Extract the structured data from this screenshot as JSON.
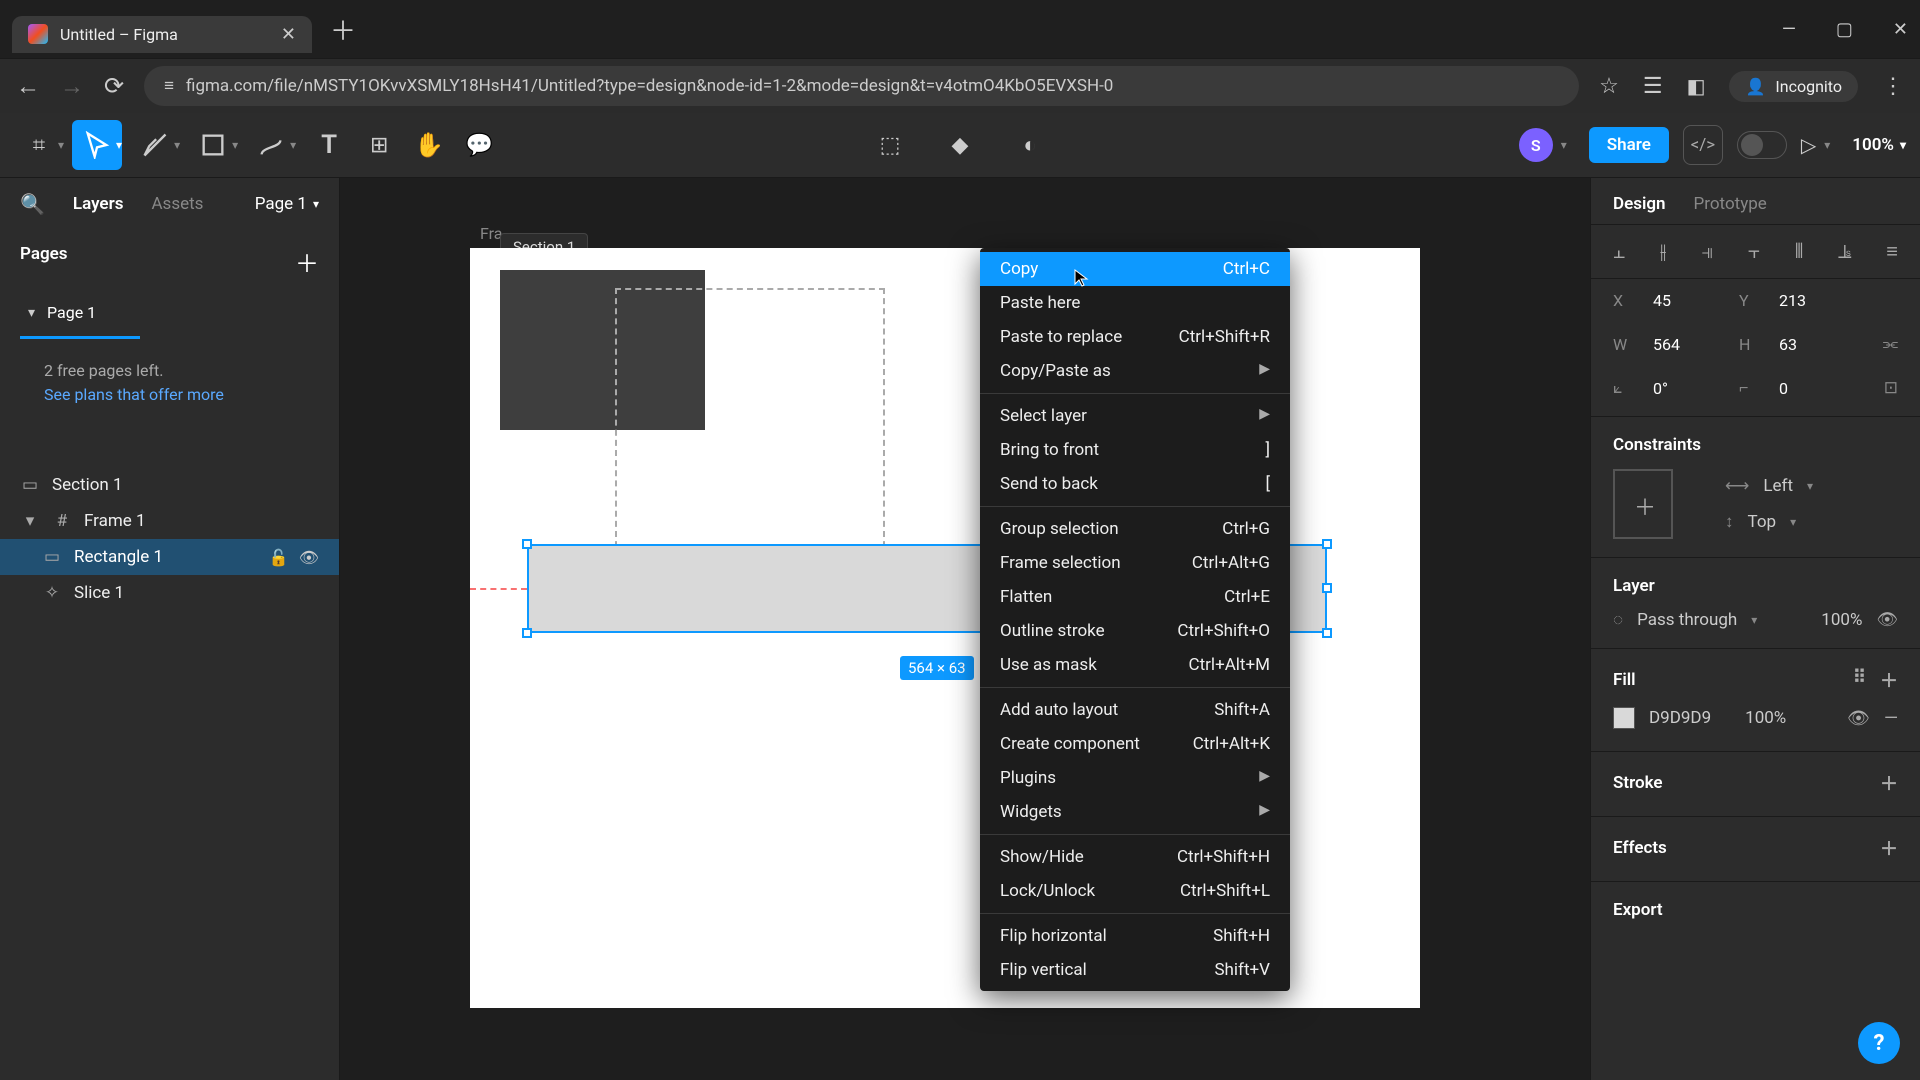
{
  "browser": {
    "tab_title": "Untitled – Figma",
    "url_prefix_icon": "≡",
    "url": "figma.com/file/nMSTY1OKvvXSMLY18HsH41/Untitled?type=design&node-id=1-2&mode=design&t=v4otmO4KbO5EVXSH-0",
    "incognito_label": "Incognito"
  },
  "toolbar": {
    "share_label": "Share",
    "zoom_label": "100%",
    "avatar_letter": "S"
  },
  "left_panel": {
    "layers_tab": "Layers",
    "assets_tab": "Assets",
    "page_selector": "Page 1",
    "pages_header": "Pages",
    "page1_label": "Page 1",
    "msg_line1": "2 free pages left.",
    "msg_link": "See plans that offer more",
    "layers": {
      "section": "Section 1",
      "frame": "Frame 1",
      "rectangle": "Rectangle 1",
      "slice": "Slice 1"
    }
  },
  "canvas": {
    "frame_label": "Fra…",
    "section_label": "Section 1",
    "size_badge": "564 × 63"
  },
  "context_menu": {
    "items": [
      {
        "label": "Copy",
        "shortcut": "Ctrl+C",
        "hl": true
      },
      {
        "label": "Paste here"
      },
      {
        "label": "Paste to replace",
        "shortcut": "Ctrl+Shift+R"
      },
      {
        "label": "Copy/Paste as",
        "arrow": true
      },
      {
        "sep": true
      },
      {
        "label": "Select layer",
        "arrow": true
      },
      {
        "label": "Bring to front",
        "shortcut": "]"
      },
      {
        "label": "Send to back",
        "shortcut": "["
      },
      {
        "sep": true
      },
      {
        "label": "Group selection",
        "shortcut": "Ctrl+G"
      },
      {
        "label": "Frame selection",
        "shortcut": "Ctrl+Alt+G"
      },
      {
        "label": "Flatten",
        "shortcut": "Ctrl+E"
      },
      {
        "label": "Outline stroke",
        "shortcut": "Ctrl+Shift+O"
      },
      {
        "label": "Use as mask",
        "shortcut": "Ctrl+Alt+M"
      },
      {
        "sep": true
      },
      {
        "label": "Add auto layout",
        "shortcut": "Shift+A"
      },
      {
        "label": "Create component",
        "shortcut": "Ctrl+Alt+K"
      },
      {
        "label": "Plugins",
        "arrow": true
      },
      {
        "label": "Widgets",
        "arrow": true
      },
      {
        "sep": true
      },
      {
        "label": "Show/Hide",
        "shortcut": "Ctrl+Shift+H"
      },
      {
        "label": "Lock/Unlock",
        "shortcut": "Ctrl+Shift+L"
      },
      {
        "sep": true
      },
      {
        "label": "Flip horizontal",
        "shortcut": "Shift+H"
      },
      {
        "label": "Flip vertical",
        "shortcut": "Shift+V"
      }
    ]
  },
  "right_panel": {
    "design_tab": "Design",
    "prototype_tab": "Prototype",
    "xl": "X",
    "xv": "45",
    "yl": "Y",
    "yv": "213",
    "wl": "W",
    "wv": "564",
    "hl": "H",
    "hv": "63",
    "rl": "⟀",
    "rv": "0°",
    "cl": "⌐",
    "cv": "0",
    "constraints_hdr": "Constraints",
    "constraint_h": "Left",
    "constraint_v": "Top",
    "layer_hdr": "Layer",
    "blend_mode": "Pass through",
    "layer_opacity": "100%",
    "fill_hdr": "Fill",
    "fill_hex": "D9D9D9",
    "fill_opacity": "100%",
    "stroke_hdr": "Stroke",
    "effects_hdr": "Effects",
    "export_hdr": "Export"
  }
}
